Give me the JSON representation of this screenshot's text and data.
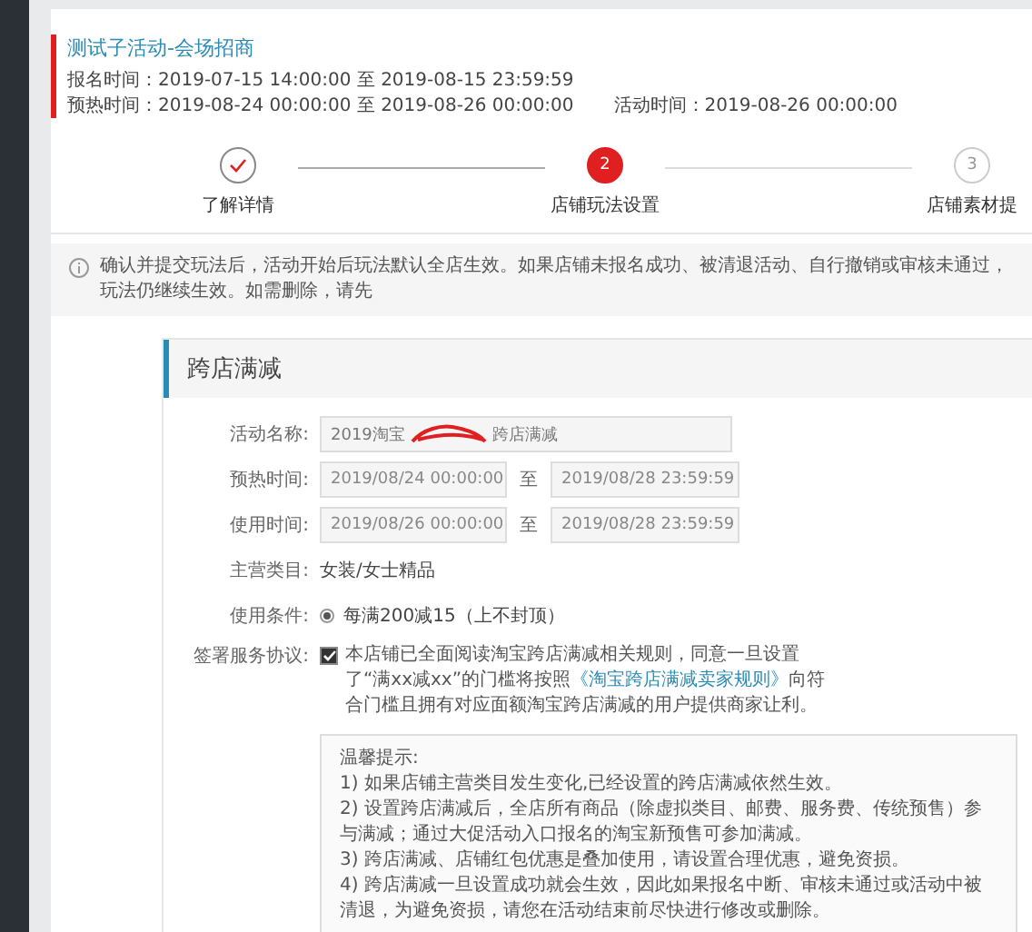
{
  "header": {
    "title": "测试子活动-会场招商",
    "times": [
      {
        "label": "报名时间：",
        "value": "2019-07-15 14:00:00 至 2019-08-15 23:59:59"
      },
      {
        "label": "预热时间：",
        "value": "2019-08-24 00:00:00 至 2019-08-26 00:00:00"
      },
      {
        "label": "活动时间：",
        "value": "2019-08-26 00:00:00"
      }
    ]
  },
  "steps": [
    {
      "label": "了解详情",
      "kind": "done"
    },
    {
      "marker": "2",
      "label": "店铺玩法设置",
      "kind": "active"
    },
    {
      "marker": "3",
      "label": "店铺素材提",
      "kind": "pending"
    }
  ],
  "notice": "确认并提交玩法后，活动开始后玩法默认全店生效。如果店铺未报名成功、被清退活动、自行撤销或审核未通过，玩法仍继续生效。如需删除，请先",
  "panel": {
    "title": "跨店满减",
    "fields": [
      {
        "kind": "text",
        "label": "活动名称:",
        "value_start": "2019淘宝",
        "value_end": "跨店满减"
      },
      {
        "kind": "range",
        "label": "预热时间:",
        "start": "2019/08/24 00:00:00",
        "separator": "至",
        "end": "2019/08/28 23:59:59"
      },
      {
        "kind": "range",
        "label": "使用时间:",
        "start": "2019/08/26 00:00:00",
        "separator": "至",
        "end": "2019/08/28 23:59:59"
      },
      {
        "kind": "static",
        "label": "主营类目:",
        "value": "女装/女士精品"
      },
      {
        "kind": "radio",
        "label": "使用条件:",
        "value": "每满200减15（上不封顶）",
        "selected": true
      }
    ],
    "agreement": {
      "label": "签署服务协议:",
      "checked": true,
      "before": "本店铺已全面阅读淘宝跨店满减相关规则，同意一旦设置了“满xx减xx”的门槛将按照",
      "link": "《淘宝跨店满减卖家规则》",
      "after": "向符合门槛且拥有对应面额淘宝跨店满减的用户提供商家让利。"
    },
    "tips": {
      "title": "温馨提示:",
      "items": [
        "1) 如果店铺主营类目发生变化,已经设置的跨店满减依然生效。",
        "2) 设置跨店满减后，全店所有商品（除虚拟类目、邮费、服务费、传统预售）参与满减；通过大促活动入口报名的淘宝新预售可参加满减。",
        "3) 跨店满减、店铺红包优惠是叠加使用，请设置合理优惠，避免资损。",
        "4) 跨店满减一旦设置成功就会生效，因此如果报名中断、审核未通过或活动中被清退，为避免资损，请您在活动结束前尽快进行修改或删除。"
      ]
    }
  }
}
